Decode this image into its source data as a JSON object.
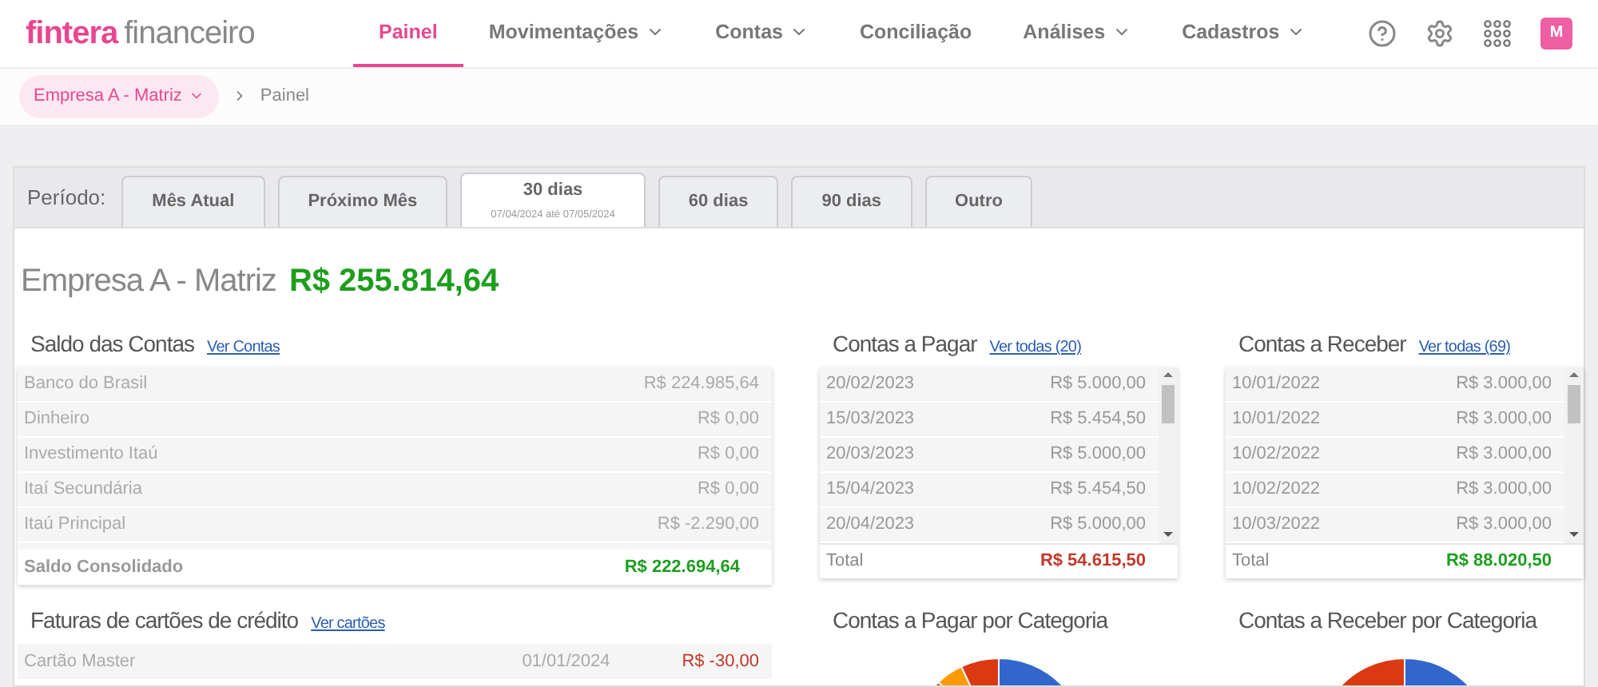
{
  "brand": {
    "name": "fintera",
    "suffix": "financeiro"
  },
  "nav": [
    {
      "label": "Painel",
      "selected": true,
      "dropdown": false
    },
    {
      "label": "Movimentações",
      "selected": false,
      "dropdown": true
    },
    {
      "label": "Contas",
      "selected": false,
      "dropdown": true
    },
    {
      "label": "Conciliação",
      "selected": false,
      "dropdown": false
    },
    {
      "label": "Análises",
      "selected": false,
      "dropdown": true
    },
    {
      "label": "Cadastros",
      "selected": false,
      "dropdown": true
    }
  ],
  "user": {
    "initial": "M"
  },
  "breadcrumb": {
    "company": "Empresa A - Matriz",
    "page": "Painel"
  },
  "period": {
    "label": "Período:",
    "tabs": [
      {
        "label": "Mês Atual",
        "selected": false
      },
      {
        "label": "Próximo Mês",
        "selected": false
      },
      {
        "label": "30 dias",
        "selected": true,
        "range": "07/04/2024 até 07/05/2024"
      },
      {
        "label": "60 dias",
        "selected": false
      },
      {
        "label": "90 dias",
        "selected": false
      },
      {
        "label": "Outro",
        "selected": false
      }
    ]
  },
  "summary": {
    "company": "Empresa A - Matriz",
    "total": "R$ 255.814,64"
  },
  "balances": {
    "title": "Saldo das Contas",
    "link": "Ver Contas",
    "rows": [
      {
        "name": "Banco do Brasil",
        "value": "R$ 224.985,64"
      },
      {
        "name": "Dinheiro",
        "value": "R$ 0,00"
      },
      {
        "name": "Investimento Itaú",
        "value": "R$ 0,00"
      },
      {
        "name": "Itaí Secundária",
        "value": "R$ 0,00"
      },
      {
        "name": "Itaú Principal",
        "value": "R$ -2.290,00"
      }
    ],
    "total_label": "Saldo Consolidado",
    "total": "R$ 222.694,64"
  },
  "cards": {
    "title": "Faturas de cartões de crédito",
    "link": "Ver cartões",
    "rows": [
      {
        "name": "Cartão Master",
        "date": "01/01/2024",
        "value": "R$ -30,00"
      }
    ]
  },
  "payables": {
    "title": "Contas a Pagar",
    "link": "Ver todas (20)",
    "rows": [
      {
        "date": "20/02/2023",
        "value": "R$ 5.000,00"
      },
      {
        "date": "15/03/2023",
        "value": "R$ 5.454,50"
      },
      {
        "date": "20/03/2023",
        "value": "R$ 5.000,00"
      },
      {
        "date": "15/04/2023",
        "value": "R$ 5.454,50"
      },
      {
        "date": "20/04/2023",
        "value": "R$ 5.000,00"
      }
    ],
    "total_label": "Total",
    "total": "R$ 54.615,50",
    "chart_title": "Contas a Pagar por Categoria"
  },
  "receivables": {
    "title": "Contas a Receber",
    "link": "Ver todas (69)",
    "rows": [
      {
        "date": "10/01/2022",
        "value": "R$ 3.000,00"
      },
      {
        "date": "10/01/2022",
        "value": "R$ 3.000,00"
      },
      {
        "date": "10/02/2022",
        "value": "R$ 3.000,00"
      },
      {
        "date": "10/02/2022",
        "value": "R$ 3.000,00"
      },
      {
        "date": "10/03/2022",
        "value": "R$ 3.000,00"
      }
    ],
    "total_label": "Total",
    "total": "R$ 88.020,50",
    "chart_title": "Contas a Receber por Categoria"
  }
}
